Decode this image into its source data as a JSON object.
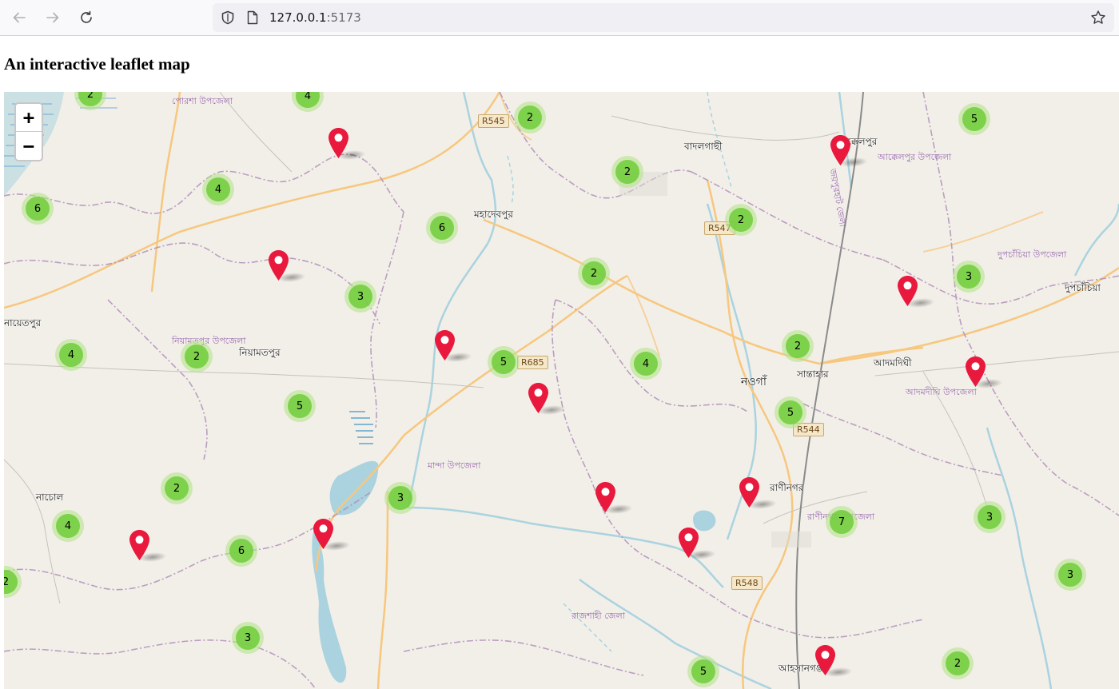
{
  "browser": {
    "url_host": "127.0.0.1",
    "url_port": ":5173",
    "back_icon": "arrow-left-icon",
    "forward_icon": "arrow-right-icon",
    "reload_icon": "reload-icon",
    "shield_icon": "shield-icon",
    "page_icon": "page-icon",
    "bookmark_icon": "star-icon"
  },
  "page": {
    "title": "An interactive leaflet map"
  },
  "map": {
    "zoom_in": "+",
    "zoom_out": "−",
    "clusters": [
      "2",
      "4",
      "2",
      "5",
      "2",
      "4",
      "6",
      "6",
      "2",
      "2",
      "3",
      "3",
      "4",
      "2",
      "5",
      "4",
      "2",
      "5",
      "5",
      "2",
      "3",
      "4",
      "6",
      "7",
      "3",
      "2",
      "3",
      "3",
      "5",
      "2"
    ],
    "places": [
      "বাদলগাছী",
      "আক্কেলপুর",
      "মহাদেবপুর",
      "নিয়ামতপুর",
      "নওগাঁ",
      "সান্তাহার",
      "আদমদিঘী",
      "দুপচাঁচিয়া",
      "রাণীনগর",
      "নাচোল",
      "আহসানগঞ্জ",
      "নায়েতপুর"
    ],
    "admin_areas": [
      "পোরশা উপজেলা",
      "আক্কেলপুর উপজেলা",
      "দুপচাঁচিয়া উপজেলা",
      "নিয়ামতপুর উপজেলা",
      "মান্দা উপজেলা",
      "আদমদীঘি উপজেলা",
      "রাণীনগর উপজেলা",
      "রাজশাহী জেলা",
      "জয়পুরহাট জেলা"
    ],
    "road_labels": [
      "R545",
      "R547",
      "R685",
      "R544",
      "R548"
    ],
    "colors": {
      "land": "#f2efe9",
      "water": "#aad3df",
      "major_road": "#f7c77e",
      "boundary": "#b18fb8",
      "cluster_outer": "#b5e28c",
      "cluster_inner": "#6ecc39",
      "marker": "#e8193d"
    }
  }
}
